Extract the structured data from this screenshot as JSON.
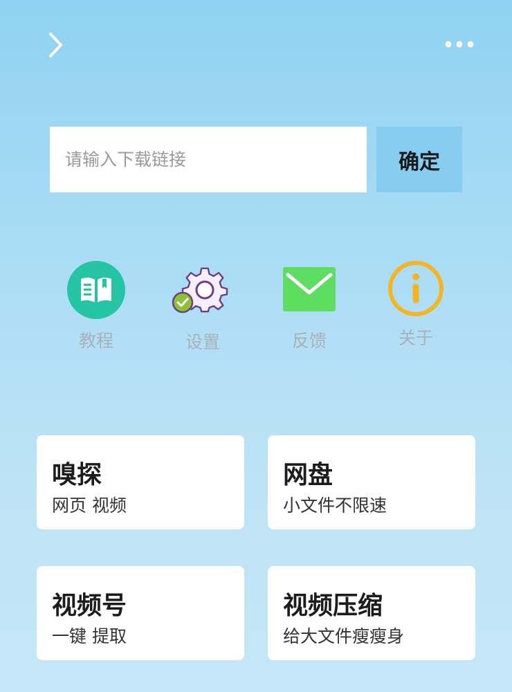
{
  "header": {
    "back_icon": "chevron-right-icon",
    "more_icon": "more-dots-icon"
  },
  "search": {
    "placeholder": "请输入下载链接",
    "value": "",
    "confirm_label": "确定"
  },
  "shortcuts": [
    {
      "id": "tutorial",
      "label": "教程",
      "icon": "book-icon",
      "color": "#25c4a4"
    },
    {
      "id": "settings",
      "label": "设置",
      "icon": "gear-icon",
      "color": "#7a4a8c"
    },
    {
      "id": "feedback",
      "label": "反馈",
      "icon": "mail-icon",
      "color": "#5fdc62"
    },
    {
      "id": "about",
      "label": "关于",
      "icon": "info-icon",
      "color": "#f4b424"
    }
  ],
  "cards": [
    {
      "id": "sniff",
      "title": "嗅探",
      "subtitle": "网页 视频"
    },
    {
      "id": "netdisk",
      "title": "网盘",
      "subtitle": "小文件不限速"
    },
    {
      "id": "channels",
      "title": "视频号",
      "subtitle": "一键 提取"
    },
    {
      "id": "compress",
      "title": "视频压缩",
      "subtitle": "给大文件瘦瘦身"
    }
  ]
}
